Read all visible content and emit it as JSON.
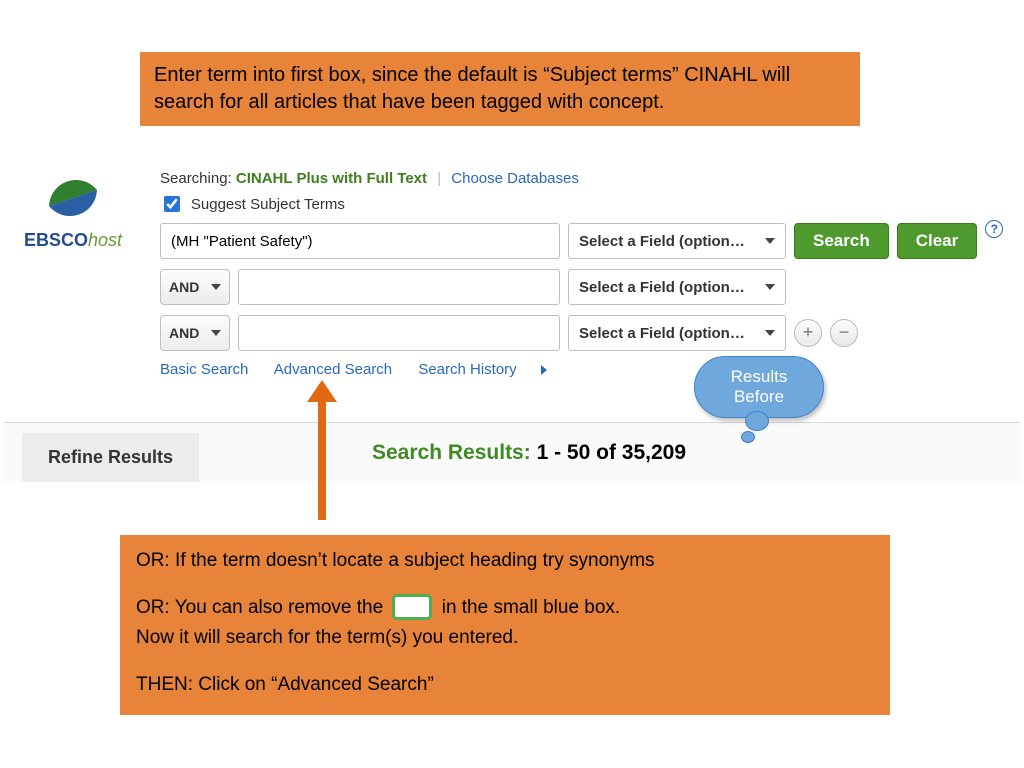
{
  "callouts": {
    "top": "Enter term into first box, since the default is “Subject terms” CINAHL will search for all articles that have been tagged with concept.",
    "bottom_l1": "OR: If the term doesn’t locate a subject heading try synonyms",
    "bottom_l2a": "OR: You can also remove the ",
    "bottom_l2b": " in the small blue box.",
    "bottom_l3": "Now it will search for the term(s) you entered.",
    "bottom_l4": "THEN: Click on “Advanced Search”",
    "cloud_l1": "Results",
    "cloud_l2": "Before"
  },
  "logo": {
    "prefix": "EBSCO",
    "suffix": "host"
  },
  "header": {
    "searching_label": "Searching:",
    "db_name": "CINAHL Plus with Full Text",
    "choose_db": "Choose Databases",
    "suggest_label": "Suggest Subject Terms"
  },
  "rows": {
    "field_label": "Select a Field (option…",
    "op": "AND",
    "term1": "(MH \"Patient Safety\")"
  },
  "buttons": {
    "search": "Search",
    "clear": "Clear",
    "help": "?",
    "plus": "+",
    "minus": "−"
  },
  "nav": {
    "basic": "Basic Search",
    "advanced": "Advanced Search",
    "history": "Search History"
  },
  "results": {
    "refine": "Refine Results",
    "label": "Search Results:",
    "count": "1 - 50 of 35,209"
  }
}
